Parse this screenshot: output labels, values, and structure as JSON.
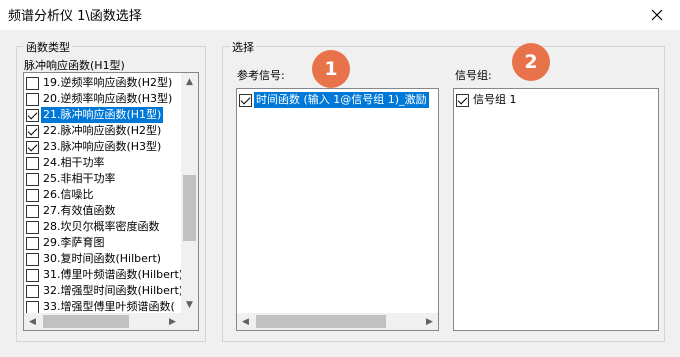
{
  "window": {
    "title": "频谱分析仪 1\\函数选择",
    "close_icon": "close-icon"
  },
  "function_type": {
    "group_label": "函数类型",
    "current": "脉冲响应函数(H1型)",
    "items": [
      {
        "label": "19.逆频率响应函数(H2型)",
        "checked": false,
        "selected": false
      },
      {
        "label": "20.逆频率响应函数(H3型)",
        "checked": false,
        "selected": false
      },
      {
        "label": "21.脉冲响应函数(H1型)",
        "checked": true,
        "selected": true
      },
      {
        "label": "22.脉冲响应函数(H2型)",
        "checked": true,
        "selected": false
      },
      {
        "label": "23.脉冲响应函数(H3型)",
        "checked": true,
        "selected": false
      },
      {
        "label": "24.相干功率",
        "checked": false,
        "selected": false
      },
      {
        "label": "25.非相干功率",
        "checked": false,
        "selected": false
      },
      {
        "label": "26.信噪比",
        "checked": false,
        "selected": false
      },
      {
        "label": "27.有效值函数",
        "checked": false,
        "selected": false
      },
      {
        "label": "28.坎贝尔概率密度函数",
        "checked": false,
        "selected": false
      },
      {
        "label": "29.李萨育图",
        "checked": false,
        "selected": false
      },
      {
        "label": "30.复时间函数(Hilbert)",
        "checked": false,
        "selected": false
      },
      {
        "label": "31.傅里叶频谱函数(Hilbert)",
        "checked": false,
        "selected": false
      },
      {
        "label": "32.增强型时间函数(Hilbert)",
        "checked": false,
        "selected": false
      },
      {
        "label": "33.增强型傅里叶频谱函数(",
        "checked": false,
        "selected": false
      }
    ]
  },
  "selection": {
    "group_label": "选择",
    "reference_label": "参考信号:",
    "signal_group_label": "信号组:",
    "reference_items": [
      {
        "label": "时间函数 (输入 1@信号组 1)_激励",
        "checked": true,
        "selected": true
      }
    ],
    "signal_group_items": [
      {
        "label": "信号组 1",
        "checked": true,
        "selected": false
      }
    ]
  },
  "badges": [
    "1",
    "2"
  ],
  "colors": {
    "badge": "#e8734a",
    "selection": "#0078d7"
  }
}
